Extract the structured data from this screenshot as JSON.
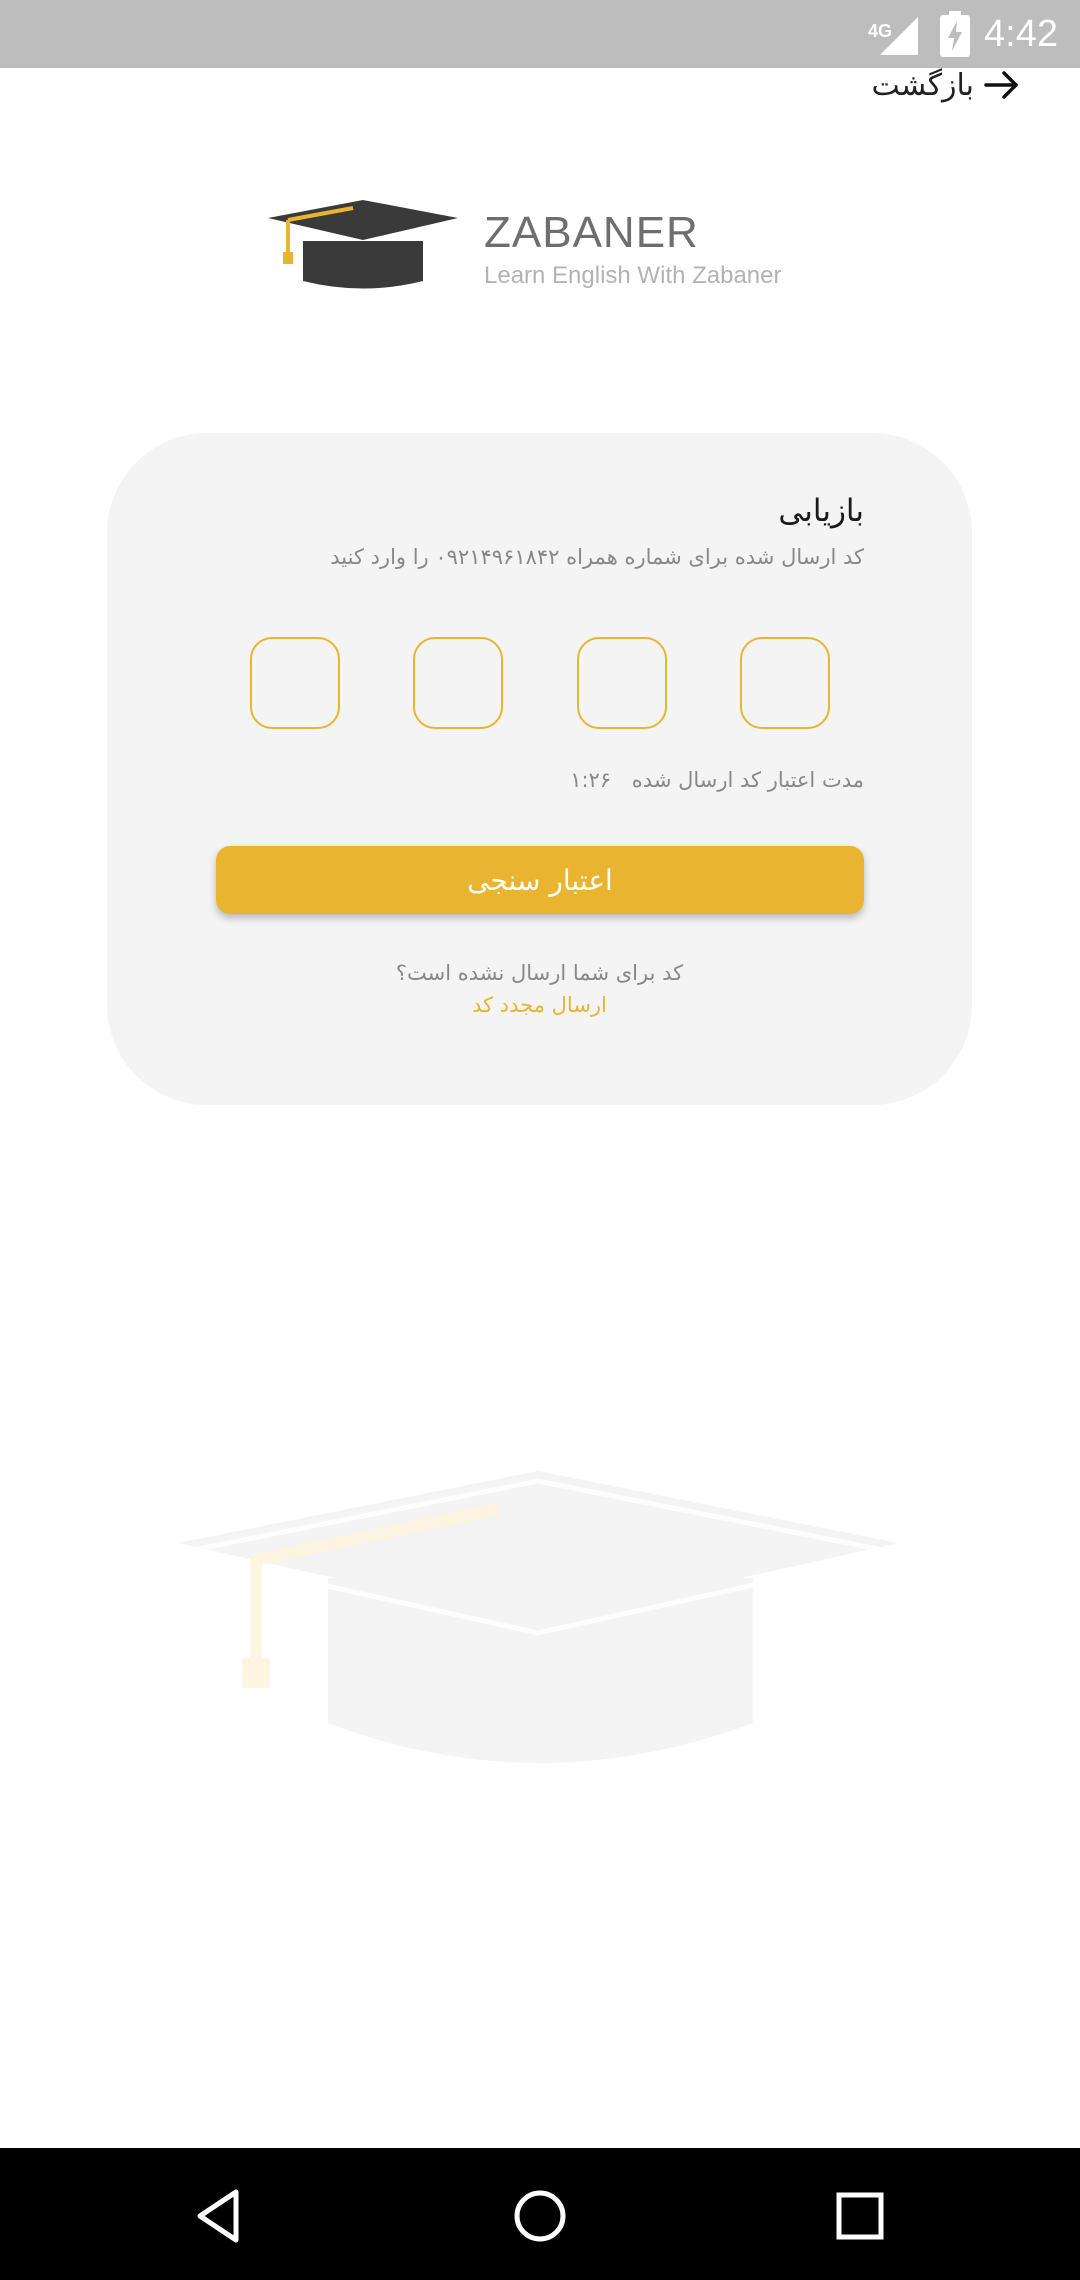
{
  "status_bar": {
    "network": "4G",
    "time": "4:42"
  },
  "header": {
    "back_label": "بازگشت"
  },
  "logo": {
    "name": "ZABANER",
    "tagline": "Learn English With Zabaner"
  },
  "card": {
    "title": "بازیابی",
    "subtitle": "کد ارسال شده برای شماره همراه ۰۹۲۱۴۹۶۱۸۴۲ را وارد کنید",
    "otp_digits": [
      "",
      "",
      "",
      ""
    ],
    "timer_label": "مدت اعتبار کد ارسال شده",
    "timer_value": "۱:۲۶",
    "verify_button": "اعتبار سنجی",
    "not_received": "کد برای شما ارسال نشده است؟",
    "resend_link": "ارسال مجدد کد"
  },
  "colors": {
    "accent": "#e9b531",
    "card_bg": "#f4f4f4",
    "status_bar": "#bdbdbd",
    "nav_bar": "#000000"
  },
  "icons": {
    "back": "arrow-right-icon",
    "logo": "graduation-cap-icon",
    "signal": "signal-icon",
    "battery": "battery-charging-icon",
    "nav_back": "triangle-back-icon",
    "nav_home": "circle-home-icon",
    "nav_recents": "square-recents-icon"
  }
}
